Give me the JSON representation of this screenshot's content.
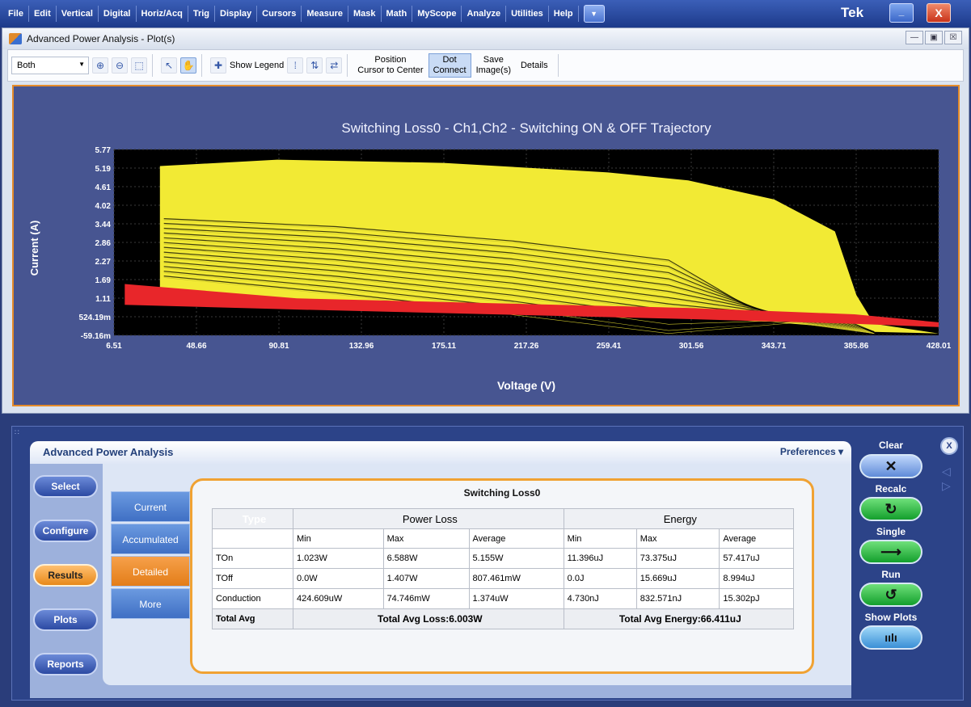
{
  "menu": {
    "items": [
      "File",
      "Edit",
      "Vertical",
      "Digital",
      "Horiz/Acq",
      "Trig",
      "Display",
      "Cursors",
      "Measure",
      "Mask",
      "Math",
      "MyScope",
      "Analyze",
      "Utilities",
      "Help"
    ],
    "dropdown_glyph": "▼",
    "brand": "Tek",
    "min_glyph": "_",
    "close_glyph": "X"
  },
  "plot_window": {
    "title": "Advanced Power Analysis - Plot(s)",
    "win_buttons": [
      "—",
      "▣",
      "☒"
    ],
    "toolbar": {
      "combo_value": "Both",
      "show_legend": "Show Legend",
      "position_cursor": [
        "Position",
        "Cursor to Center"
      ],
      "dot_connect": [
        "Dot",
        "Connect"
      ],
      "save_images": [
        "Save",
        "Image(s)"
      ],
      "details": "Details"
    }
  },
  "chart_data": {
    "type": "scatter",
    "title": "Switching Loss0 - Ch1,Ch2 - Switching ON & OFF Trajectory",
    "xlabel": "Voltage (V)",
    "ylabel": "Current (A)",
    "x_ticks": [
      "6.51",
      "48.66",
      "90.81",
      "132.96",
      "175.11",
      "217.26",
      "259.41",
      "301.56",
      "343.71",
      "385.86",
      "428.01"
    ],
    "y_ticks": [
      "5.77",
      "5.19",
      "4.61",
      "4.02",
      "3.44",
      "2.86",
      "2.27",
      "1.69",
      "1.11",
      "524.19m",
      "-59.16m"
    ],
    "xlim": [
      6.51,
      428.01
    ],
    "ylim": [
      -0.05916,
      5.77
    ],
    "grid": true,
    "colors": {
      "on": "#f2ea34",
      "off": "#e8262a",
      "trace": "#c9c22a",
      "background": "#000000"
    },
    "series": [
      {
        "x": [
          30,
          30,
          90,
          175,
          259,
          300,
          344,
          375,
          386,
          395,
          428
        ],
        "y_top": [
          4.6,
          5.25,
          5.45,
          5.35,
          5.05,
          4.8,
          4.2,
          3.2,
          1.2,
          0.3,
          0.0
        ],
        "y_bottom": [
          1.7,
          1.4,
          1.1,
          0.9,
          0.7,
          0.5,
          0.35,
          0.2,
          0.1,
          0.05,
          0.0
        ]
      },
      {
        "x": [
          12,
          100,
          200,
          300,
          385,
          428
        ],
        "y_top": [
          1.55,
          1.1,
          0.95,
          0.8,
          0.6,
          0.35
        ],
        "y_bottom": [
          0.9,
          0.75,
          0.6,
          0.45,
          0.3,
          0.2
        ]
      }
    ],
    "trajectory_start_y": [
      3.6,
      3.45,
      3.3,
      3.15,
      3.0,
      2.85,
      2.7,
      2.55,
      2.4,
      2.25,
      2.1,
      1.95,
      1.8
    ]
  },
  "panel": {
    "grip": "∷",
    "title": "Advanced Power Analysis",
    "preferences": "Preferences ▾",
    "nav": [
      "Select",
      "Configure",
      "Results",
      "Plots",
      "Reports"
    ],
    "subtabs": [
      "Current",
      "Accumulated",
      "Detailed",
      "More"
    ],
    "result_title": "Switching Loss0",
    "table": {
      "type_hdr": "Type",
      "group_power": "Power Loss",
      "group_energy": "Energy",
      "sub": [
        "Min",
        "Max",
        "Average",
        "Min",
        "Max",
        "Average"
      ],
      "rows": [
        {
          "name": "TOn",
          "cells": [
            "1.023W",
            "6.588W",
            "5.155W",
            "11.396uJ",
            "73.375uJ",
            "57.417uJ"
          ]
        },
        {
          "name": "TOff",
          "cells": [
            "0.0W",
            "1.407W",
            "807.461mW",
            "0.0J",
            "15.669uJ",
            "8.994uJ"
          ]
        },
        {
          "name": "Conduction",
          "cells": [
            "424.609uW",
            "74.746mW",
            "1.374uW",
            "4.730nJ",
            "832.571nJ",
            "15.302pJ"
          ]
        }
      ],
      "total_label": "Total Avg",
      "total_loss": "Total Avg Loss:6.003W",
      "total_energy": "Total Avg Energy:66.411uJ"
    },
    "controls": {
      "clear": "Clear",
      "clear_glyph": "✕",
      "recalc": "Recalc",
      "recalc_glyph": "↻",
      "single": "Single",
      "single_glyph": "⟶",
      "run": "Run",
      "run_glyph": "↺",
      "show_plots": "Show Plots",
      "show_plots_glyph": "ıılı"
    },
    "close_glyph": "X"
  }
}
